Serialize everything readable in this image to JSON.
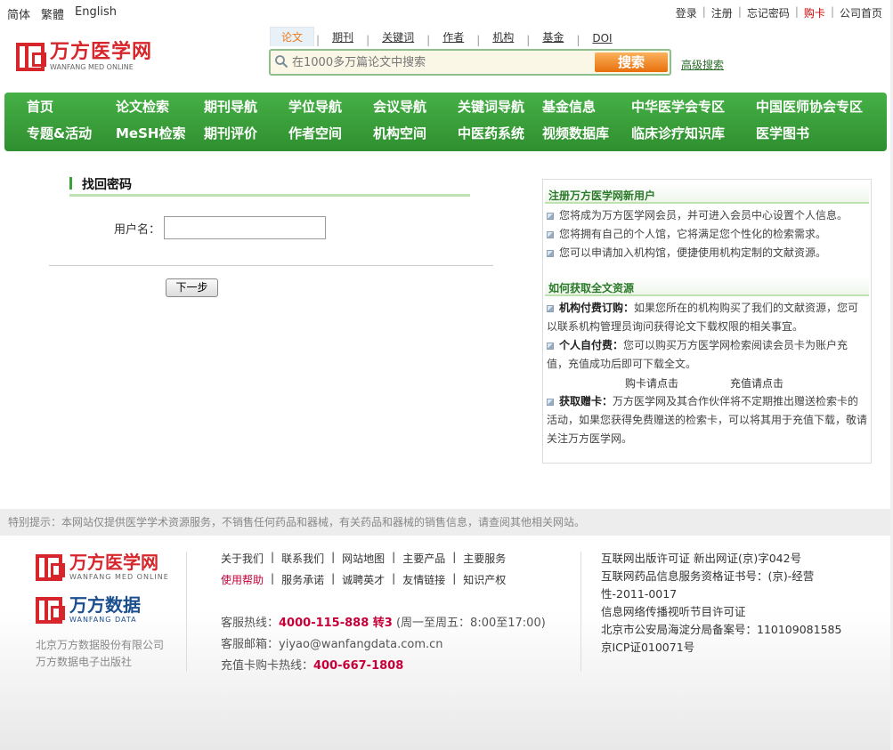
{
  "top": {
    "languages": [
      "简体",
      "繁體",
      "English"
    ],
    "links": [
      "登录",
      "注册",
      "忘记密码",
      "购卡",
      "公司首页"
    ]
  },
  "logo": {
    "cn": "万方医学网",
    "en": "WANFANG MED ONLINE"
  },
  "search": {
    "tabs": [
      "论文",
      "期刊",
      "关键词",
      "作者",
      "机构",
      "基金",
      "DOI"
    ],
    "active_tab": "论文",
    "placeholder": "在1000多万篇论文中搜索",
    "button": "搜索",
    "advanced": "高级搜索"
  },
  "nav": {
    "row1": [
      "首页",
      "论文检索",
      "期刊导航",
      "学位导航",
      "会议导航",
      "关键词导航",
      "基金信息",
      "中华医学会专区",
      "中国医师协会专区"
    ],
    "row2": [
      "专题&活动",
      "MeSH检索",
      "期刊评价",
      "作者空间",
      "机构空间",
      "中医药系统",
      "视频数据库",
      "临床诊疗知识库",
      "医学图书"
    ]
  },
  "form": {
    "title": "找回密码",
    "username_label": "用户名：",
    "username_value": "",
    "next_button": "下一步"
  },
  "sidebar": {
    "register_title": "注册万方医学网新用户",
    "register_items": [
      "您将成为万方医学网会员，并可进入会员中心设置个人信息。",
      "您将拥有自己的个人馆，它将满足您个性化的检索需求。",
      "您可以申请加入机构馆，便捷使用机构定制的文献资源。"
    ],
    "fulltext_title": "如何获取全文资源",
    "institution_label": "机构付费订购：",
    "institution_text": "如果您所在的机构购买了我们的文献资源，您可以联系机构管理员询问获得论文下载权限的相关事宜。",
    "personal_label": "个人自付费：",
    "personal_text": "您可以购买万方医学网检索阅读会员卡为账户充值，充值成功后即可下载全文。",
    "buy_card": "购卡请点击",
    "recharge": "充值请点击",
    "gift_label": "获取赠卡：",
    "gift_text": "万方医学网及其合作伙伴将不定期推出赠送检索卡的活动，如果您获得免费赠送的检索卡，可以将其用于充值下载，敬请关注万方医学网。"
  },
  "footer": {
    "notice": "特别提示：本网站仅提供医学学术资源服务，不销售任何药品和器械，有关药品和器械的销售信息，请查阅其他相关网站。",
    "logo1": {
      "cn": "万方医学网",
      "en": "WANFANG MED ONLINE"
    },
    "logo2": {
      "cn": "万方数据",
      "en": "WANFANG DATA"
    },
    "company1": "北京万方数据股份有限公司",
    "company2": "万方数据电子出版社",
    "links_row1": [
      "关于我们",
      "联系我们",
      "网站地图",
      "主要产品",
      "主要服务"
    ],
    "links_row2": [
      "使用帮助",
      "服务承诺",
      "诚聘英才",
      "友情链接",
      "知识产权"
    ],
    "hotline_label": "客服热线：",
    "hotline": "4000-115-888 转3",
    "hotline_hours": "(周一至周五：8:00至17:00)",
    "email_label": "客服邮箱：",
    "email": "yiyao@wanfangdata.com.cn",
    "card_label": "充值卡购卡热线：",
    "card_hotline": "400-667-1808",
    "licenses": [
      "互联网出版许可证 新出网证(京)字042号",
      "互联网药品信息服务资格证书号：(京)-经营性-2011-0017",
      "信息网络传播视听节目许可证",
      "北京市公安局海淀分局备案号：110109081585",
      "京ICP证010071号"
    ]
  },
  "colors": {
    "brand_red": "#d7262b",
    "nav_green": "#3a9f3a",
    "accent_orange": "#ef7a1a"
  }
}
